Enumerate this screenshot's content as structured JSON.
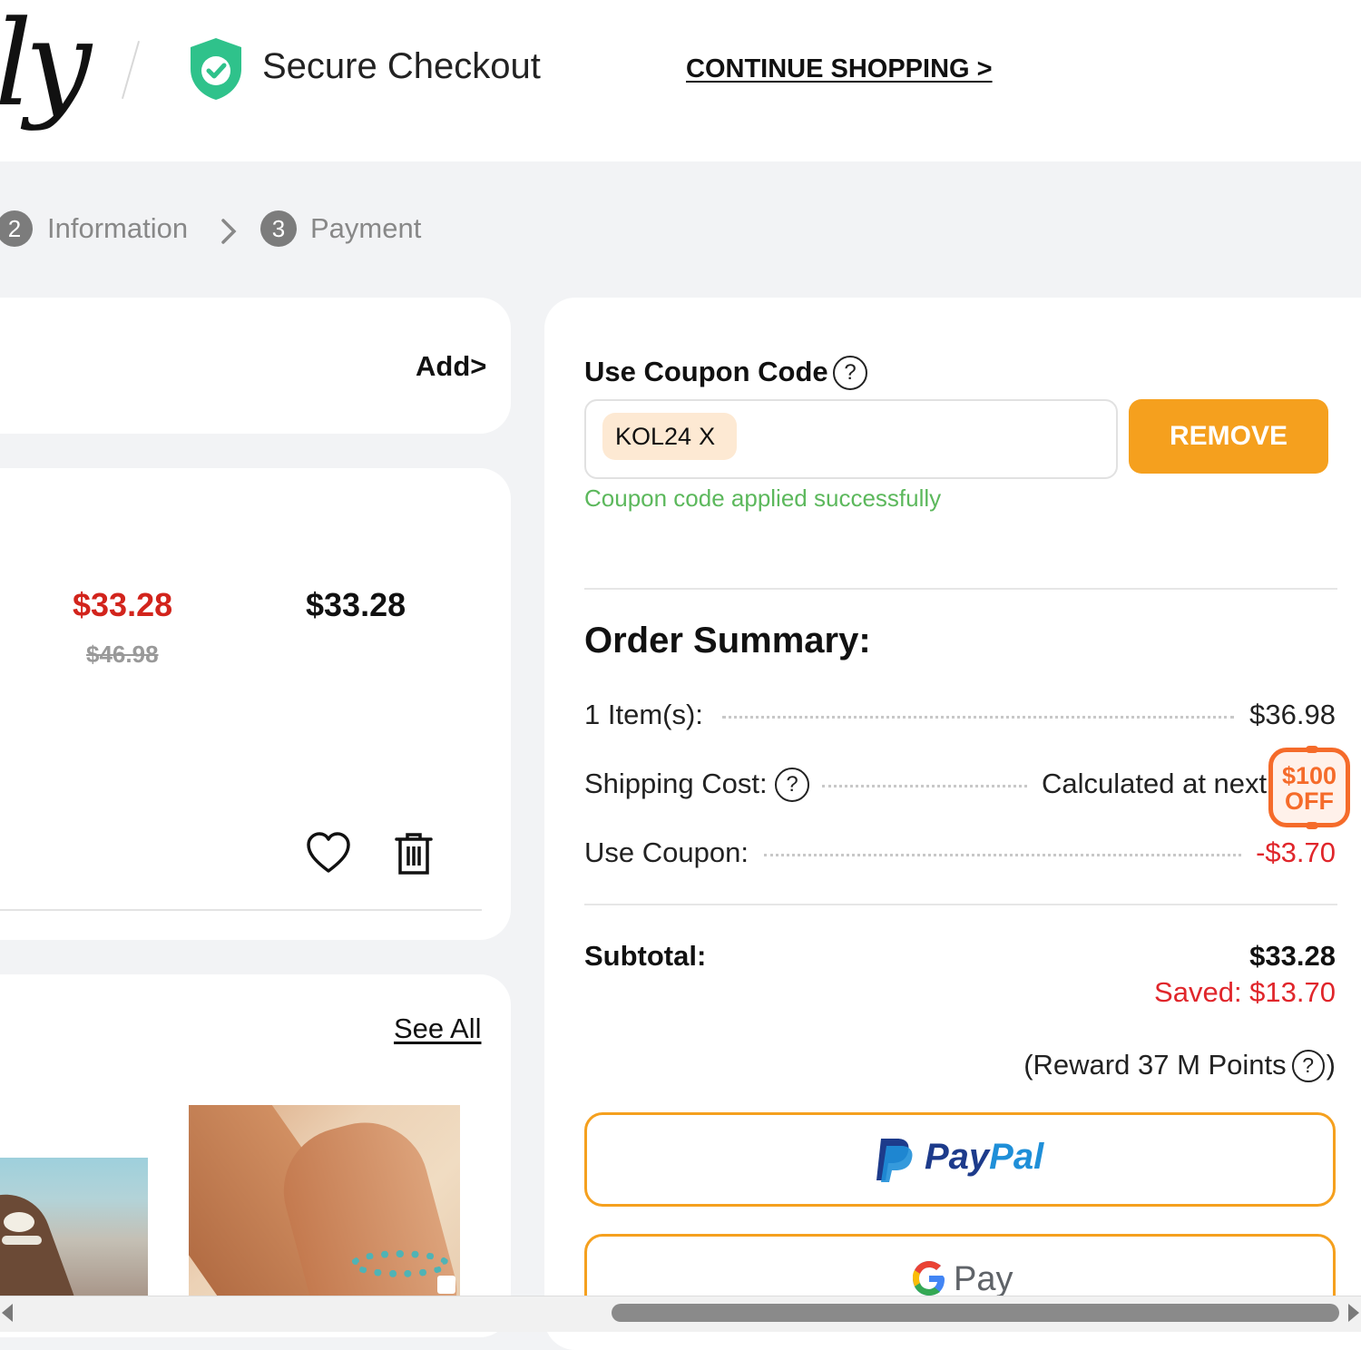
{
  "header": {
    "logo_text": "ly",
    "secure_label": "Secure Checkout",
    "continue_label": "CONTINUE SHOPPING >"
  },
  "steps": [
    {
      "num": "2",
      "label": "Information"
    },
    {
      "num": "3",
      "label": "Payment"
    }
  ],
  "address": {
    "add_label": "Add>"
  },
  "item": {
    "sale_price": "$33.28",
    "original_price": "$46.98",
    "total_price": "$33.28"
  },
  "recommendations": {
    "see_all_label": "See All"
  },
  "coupon": {
    "title": "Use Coupon Code",
    "help": "?",
    "code": "KOL24",
    "chip_remove": "X",
    "remove_label": "REMOVE",
    "success_message": "Coupon code applied successfully"
  },
  "summary": {
    "title": "Order Summary:",
    "items_label": "1 Item(s):",
    "items_value": "$36.98",
    "shipping_label": "Shipping Cost:",
    "shipping_help": "?",
    "shipping_value": "Calculated at next",
    "coupon_label": "Use Coupon:",
    "coupon_value": "-$3.70",
    "badge_line1": "$100",
    "badge_line2": "OFF",
    "subtotal_label": "Subtotal:",
    "subtotal_value": "$33.28",
    "saved_text": "Saved: $13.70",
    "reward_text": "(Reward 37 M Points",
    "reward_help": "?",
    "reward_close": ")"
  },
  "payment": {
    "paypal_pay": "Pay",
    "paypal_pal": "Pal",
    "gpay_label": "Pay"
  },
  "colors": {
    "accent_orange": "#f5a01e",
    "sale_red": "#d2241c",
    "success_green": "#5cb85c",
    "badge_orange": "#f56b2a"
  }
}
